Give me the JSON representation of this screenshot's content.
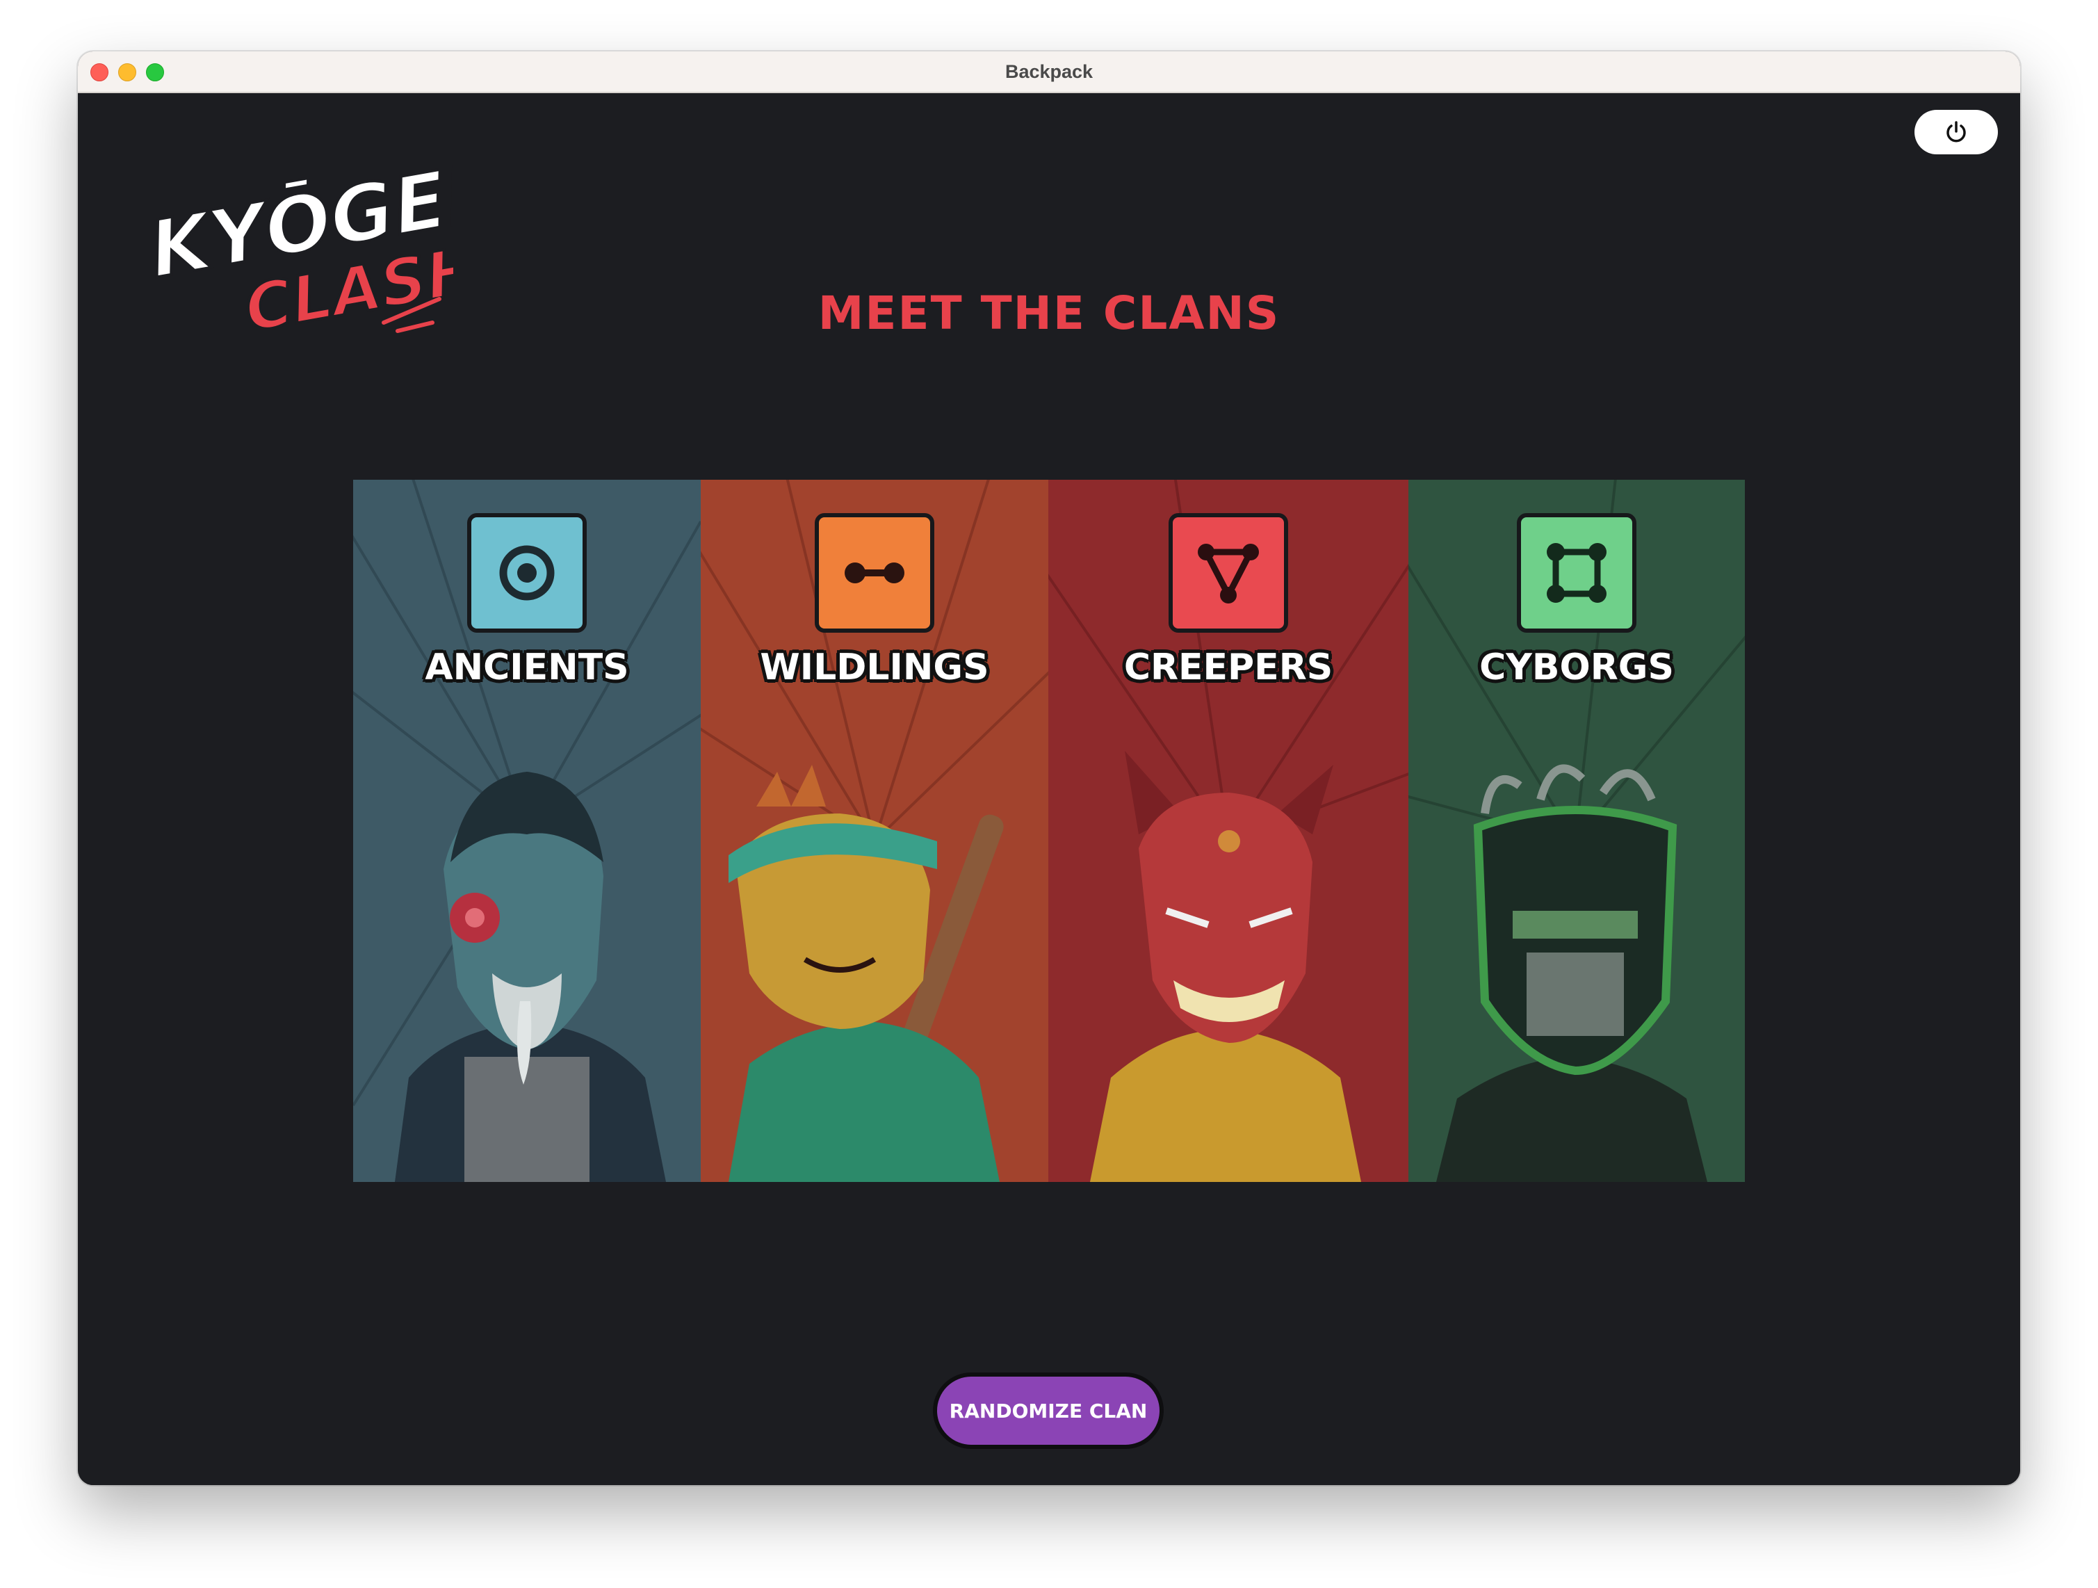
{
  "window": {
    "title": "Backpack"
  },
  "logo": {
    "line1": "KYŌGEN",
    "line2": "CLASH"
  },
  "header": {
    "power_icon": "power-icon"
  },
  "page": {
    "title": "MEET THE CLANS"
  },
  "clans": [
    {
      "name": "ANCIENTS",
      "icon": "target-circle-icon",
      "color": "#3e5a66",
      "emblem_color": "#6fc0d0"
    },
    {
      "name": "WILDLINGS",
      "icon": "dumbbell-link-icon",
      "color": "#a2432d",
      "emblem_color": "#f0803a"
    },
    {
      "name": "CREEPERS",
      "icon": "triangle-nodes-icon",
      "color": "#8e2a2c",
      "emblem_color": "#e94a50"
    },
    {
      "name": "CYBORGS",
      "icon": "square-nodes-icon",
      "color": "#2f5440",
      "emblem_color": "#6fd08a"
    }
  ],
  "actions": {
    "randomize_label": "RANDOMIZE CLAN"
  },
  "colors": {
    "accent": "#e8424b",
    "button": "#8b44b5",
    "background": "#1c1d21"
  }
}
